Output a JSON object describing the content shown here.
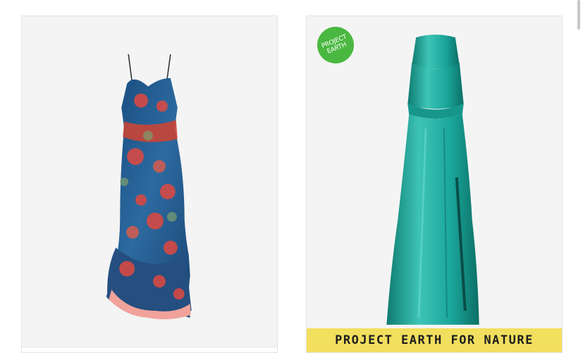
{
  "products": [
    {
      "name": "floral-satin-dress",
      "image_icon": "floral-midi-dress-image",
      "palette": {
        "base": "#1f4f86",
        "flower": "#e0483f",
        "accent": "#f0a29b"
      }
    },
    {
      "name": "teal-satin-gown",
      "image_icon": "teal-halter-gown-image",
      "palette": {
        "base": "#1aa69a",
        "highlight": "#5fd0c2",
        "shadow": "#0c6f66"
      },
      "badge": {
        "line1": "PROJECT",
        "line2": "EARTH",
        "color": "#4ab840"
      },
      "banner": {
        "label": "PROJECT EARTH FOR NATURE",
        "color": "#f2df5e"
      }
    }
  ]
}
